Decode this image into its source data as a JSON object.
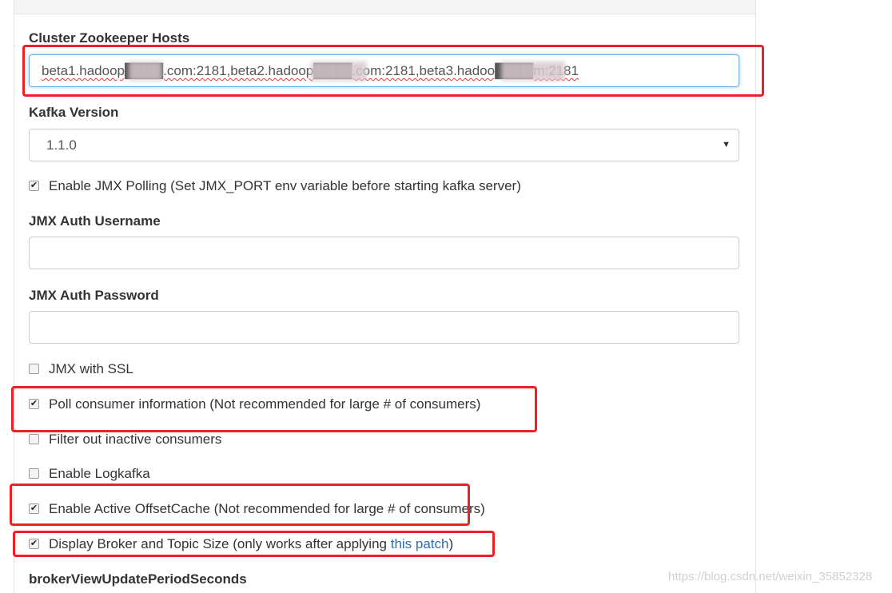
{
  "form": {
    "zk_hosts": {
      "label": "Cluster Zookeeper Hosts",
      "value": "beta1.hadoop████.com:2181,beta2.hadoop████.com:2181,beta3.hadoo████m:2181"
    },
    "kafka_version": {
      "label": "Kafka Version",
      "selected": "1.1.0"
    },
    "jmx_polling": {
      "checked": true,
      "label": "Enable JMX Polling (Set JMX_PORT env variable before starting kafka server)"
    },
    "jmx_username": {
      "label": "JMX Auth Username",
      "value": ""
    },
    "jmx_password": {
      "label": "JMX Auth Password",
      "value": ""
    },
    "jmx_ssl": {
      "checked": false,
      "label": "JMX with SSL"
    },
    "poll_consumer": {
      "checked": true,
      "label": "Poll consumer information (Not recommended for large # of consumers)"
    },
    "filter_inactive": {
      "checked": false,
      "label": "Filter out inactive consumers"
    },
    "logkafka": {
      "checked": false,
      "label": "Enable Logkafka"
    },
    "active_offset_cache": {
      "checked": true,
      "label": "Enable Active OffsetCache (Not recommended for large # of consumers)"
    },
    "display_size": {
      "checked": true,
      "label_prefix": "Display Broker and Topic Size (only works after applying ",
      "link_text": "this patch",
      "label_suffix": ")"
    },
    "broker_view_update": {
      "label": "brokerViewUpdatePeriodSeconds"
    }
  },
  "watermark": "https://blog.csdn.net/weixin_35852328",
  "colors": {
    "highlight": "#ef2121",
    "link": "#2a6fb0",
    "focus": "#66afe9"
  }
}
